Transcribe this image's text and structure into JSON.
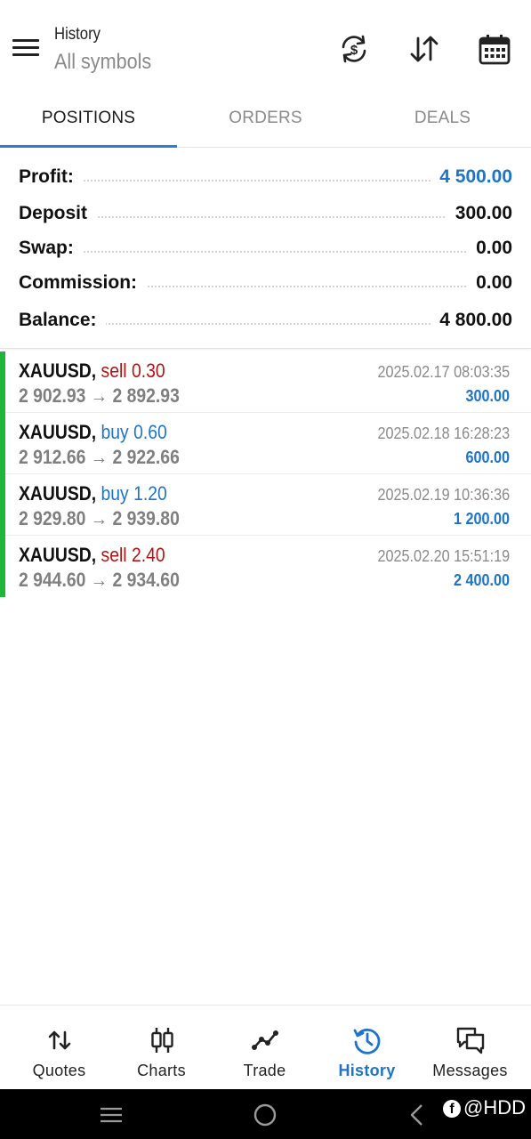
{
  "header": {
    "title": "History",
    "subtitle": "All symbols",
    "icons": [
      "currency-exchange-icon",
      "sort-icon",
      "calendar-icon"
    ]
  },
  "tabs": [
    {
      "label": "POSITIONS",
      "active": true
    },
    {
      "label": "ORDERS",
      "active": false
    },
    {
      "label": "DEALS",
      "active": false
    }
  ],
  "summary": {
    "profit": {
      "label": "Profit:",
      "value": "4 500.00"
    },
    "deposit": {
      "label": "Deposit",
      "value": "300.00"
    },
    "swap": {
      "label": "Swap:",
      "value": "0.00"
    },
    "commission": {
      "label": "Commission:",
      "value": "0.00"
    },
    "balance": {
      "label": "Balance:",
      "value": "4 800.00"
    }
  },
  "deals": [
    {
      "symbol": "XAUUSD,",
      "side": "sell 0.30",
      "prices": "2 902.93 → 2 892.93",
      "time": "2025.02.17 08:03:35",
      "profit": "300.00"
    },
    {
      "symbol": "XAUUSD,",
      "side": "buy 0.60",
      "prices": "2 912.66 → 2 922.66",
      "time": "2025.02.18 16:28:23",
      "profit": "600.00"
    },
    {
      "symbol": "XAUUSD,",
      "side": "buy 1.20",
      "prices": "2 929.80 → 2 939.80",
      "time": "2025.02.19 10:36:36",
      "profit": "1 200.00"
    },
    {
      "symbol": "XAUUSD,",
      "side": "sell 2.40",
      "prices": "2 944.60 → 2 934.60",
      "time": "2025.02.20 15:51:19",
      "profit": "2 400.00"
    }
  ],
  "bottom_nav": [
    {
      "label": "Quotes",
      "icon": "quotes-icon",
      "active": false
    },
    {
      "label": "Charts",
      "icon": "candlestick-icon",
      "active": false
    },
    {
      "label": "Trade",
      "icon": "trade-line-icon",
      "active": false
    },
    {
      "label": "History",
      "icon": "history-icon",
      "active": true
    },
    {
      "label": "Messages",
      "icon": "messages-icon",
      "active": false
    }
  ],
  "watermark": "@HDD",
  "colors": {
    "accent": "#1d74c9",
    "sell": "#b51313",
    "buy": "#1d74c9",
    "position_bar": "#1fb53d",
    "tab_indicator": "#2a7fd0"
  }
}
